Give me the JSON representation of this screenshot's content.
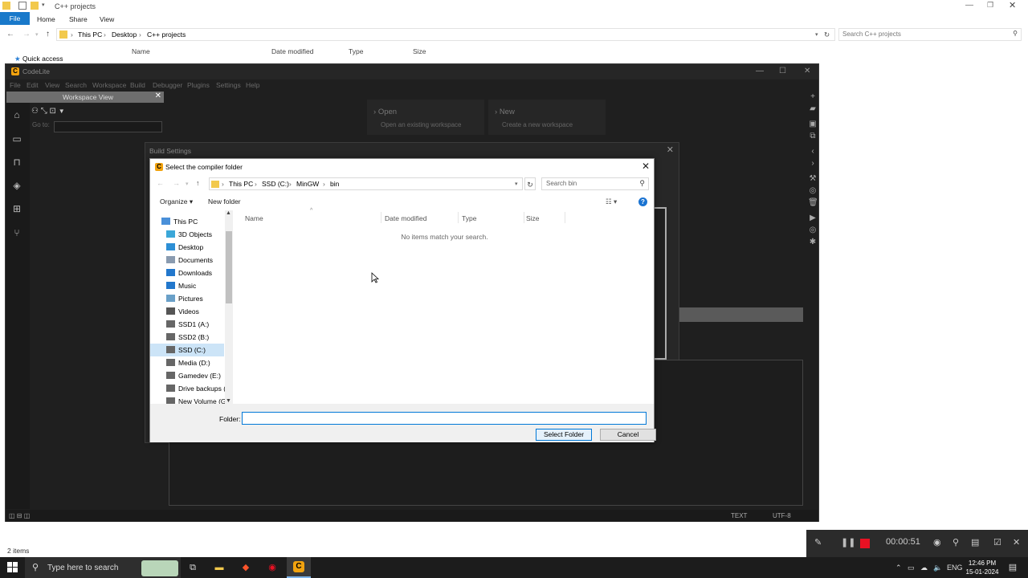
{
  "explorer": {
    "title": "C++ projects",
    "ribbon_tabs": [
      "File",
      "Home",
      "Share",
      "View"
    ],
    "breadcrumb": [
      "This PC",
      "Desktop",
      "C++ projects"
    ],
    "search_placeholder": "Search C++ projects",
    "quick_access": "Quick access",
    "columns": [
      "Name",
      "Date modified",
      "Type",
      "Size"
    ],
    "status": "2 items"
  },
  "codelite": {
    "title": "CodeLite",
    "menu": [
      "File",
      "Edit",
      "View",
      "Search",
      "Workspace",
      "Build",
      "Debugger",
      "Plugins",
      "Settings",
      "Help"
    ],
    "workspace_view": "Workspace View",
    "goto_label": "Go to:",
    "cards": [
      {
        "title": "Open",
        "subtitle": "Open an existing workspace"
      },
      {
        "title": "New",
        "subtitle": "Create a new workspace"
      }
    ],
    "status_text": "TEXT",
    "status_encoding": "UTF-8"
  },
  "build_settings": {
    "title": "Build Settings"
  },
  "file_dialog": {
    "title": "Select the compiler folder",
    "breadcrumb": [
      "This PC",
      "SSD (C:)",
      "MinGW",
      "bin"
    ],
    "search_placeholder": "Search bin",
    "organize": "Organize ▾",
    "new_folder": "New folder",
    "nav_items": [
      {
        "label": "This PC",
        "icon": "pc-icon",
        "color": "#4a90d9"
      },
      {
        "label": "3D Objects",
        "icon": "3d-objects-icon",
        "color": "#3ba7d8"
      },
      {
        "label": "Desktop",
        "icon": "desktop-icon",
        "color": "#2d8fd5"
      },
      {
        "label": "Documents",
        "icon": "documents-icon",
        "color": "#8a9bb0"
      },
      {
        "label": "Downloads",
        "icon": "downloads-icon",
        "color": "#2277cc"
      },
      {
        "label": "Music",
        "icon": "music-icon",
        "color": "#2277cc"
      },
      {
        "label": "Pictures",
        "icon": "pictures-icon",
        "color": "#6aa0c8"
      },
      {
        "label": "Videos",
        "icon": "videos-icon",
        "color": "#555"
      },
      {
        "label": "SSD1 (A:)",
        "icon": "drive-icon",
        "color": "#666"
      },
      {
        "label": "SSD2 (B:)",
        "icon": "drive-icon",
        "color": "#666"
      },
      {
        "label": "SSD (C:)",
        "icon": "drive-icon",
        "color": "#666"
      },
      {
        "label": "Media (D:)",
        "icon": "drive-icon",
        "color": "#666"
      },
      {
        "label": "Gamedev (E:)",
        "icon": "drive-icon",
        "color": "#666"
      },
      {
        "label": "Drive backups (F",
        "icon": "drive-icon",
        "color": "#666"
      },
      {
        "label": "New Volume (G:",
        "icon": "drive-icon",
        "color": "#666"
      }
    ],
    "selected_nav": "SSD (C:)",
    "columns": [
      "Name",
      "Date modified",
      "Type",
      "Size"
    ],
    "empty_message": "No items match your search.",
    "folder_label": "Folder:",
    "folder_value": "",
    "select_button": "Select Folder",
    "cancel_button": "Cancel"
  },
  "recorder": {
    "time": "00:00:51",
    "stop_color": "#e81123"
  },
  "taskbar": {
    "search_placeholder": "Type here to search",
    "language": "ENG",
    "time": "12:46 PM",
    "date": "15-01-2024"
  }
}
